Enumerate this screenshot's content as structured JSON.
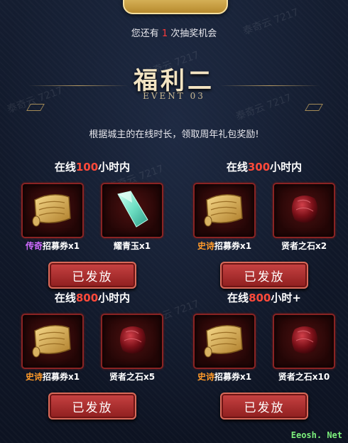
{
  "header": {
    "chances_prefix": "您还有",
    "chances_count": "1",
    "chances_suffix": "次抽奖机会"
  },
  "event": {
    "title": "福利二",
    "subtitle": "EVENT 03",
    "description": "根据城主的在线时长，领取周年礼包奖励!"
  },
  "groups": [
    {
      "title_prefix": "在线",
      "hours": "100",
      "title_suffix": "小时内",
      "items": [
        {
          "icon": "scroll-icon",
          "quality": "传奇",
          "name": "招募券x1"
        },
        {
          "icon": "crystal-icon",
          "quality": "",
          "name": "耀青玉x1"
        }
      ],
      "button": "已发放"
    },
    {
      "title_prefix": "在线",
      "hours": "300",
      "title_suffix": "小时内",
      "items": [
        {
          "icon": "scroll-icon",
          "quality": "史诗",
          "name": "招募券x1"
        },
        {
          "icon": "red-stone-icon",
          "quality": "",
          "name": "贤者之石x2"
        }
      ],
      "button": "已发放"
    },
    {
      "title_prefix": "在线",
      "hours": "800",
      "title_suffix": "小时内",
      "items": [
        {
          "icon": "scroll-icon",
          "quality": "史诗",
          "name": "招募券x1"
        },
        {
          "icon": "red-stone-icon",
          "quality": "",
          "name": "贤者之石x5"
        }
      ],
      "button": "已发放"
    },
    {
      "title_prefix": "在线",
      "hours": "800",
      "title_suffix": "小时+",
      "items": [
        {
          "icon": "scroll-icon",
          "quality": "史诗",
          "name": "招募券x1"
        },
        {
          "icon": "red-stone-icon",
          "quality": "",
          "name": "贤者之石x10"
        }
      ],
      "button": "已发放"
    }
  ],
  "watermark": "泰奇云 7217",
  "corner_mark": "Eeosh. Net",
  "colors": {
    "highlight": "#ff4a3a",
    "legendary": "#cf6bff",
    "epic": "#ff9a2a"
  }
}
